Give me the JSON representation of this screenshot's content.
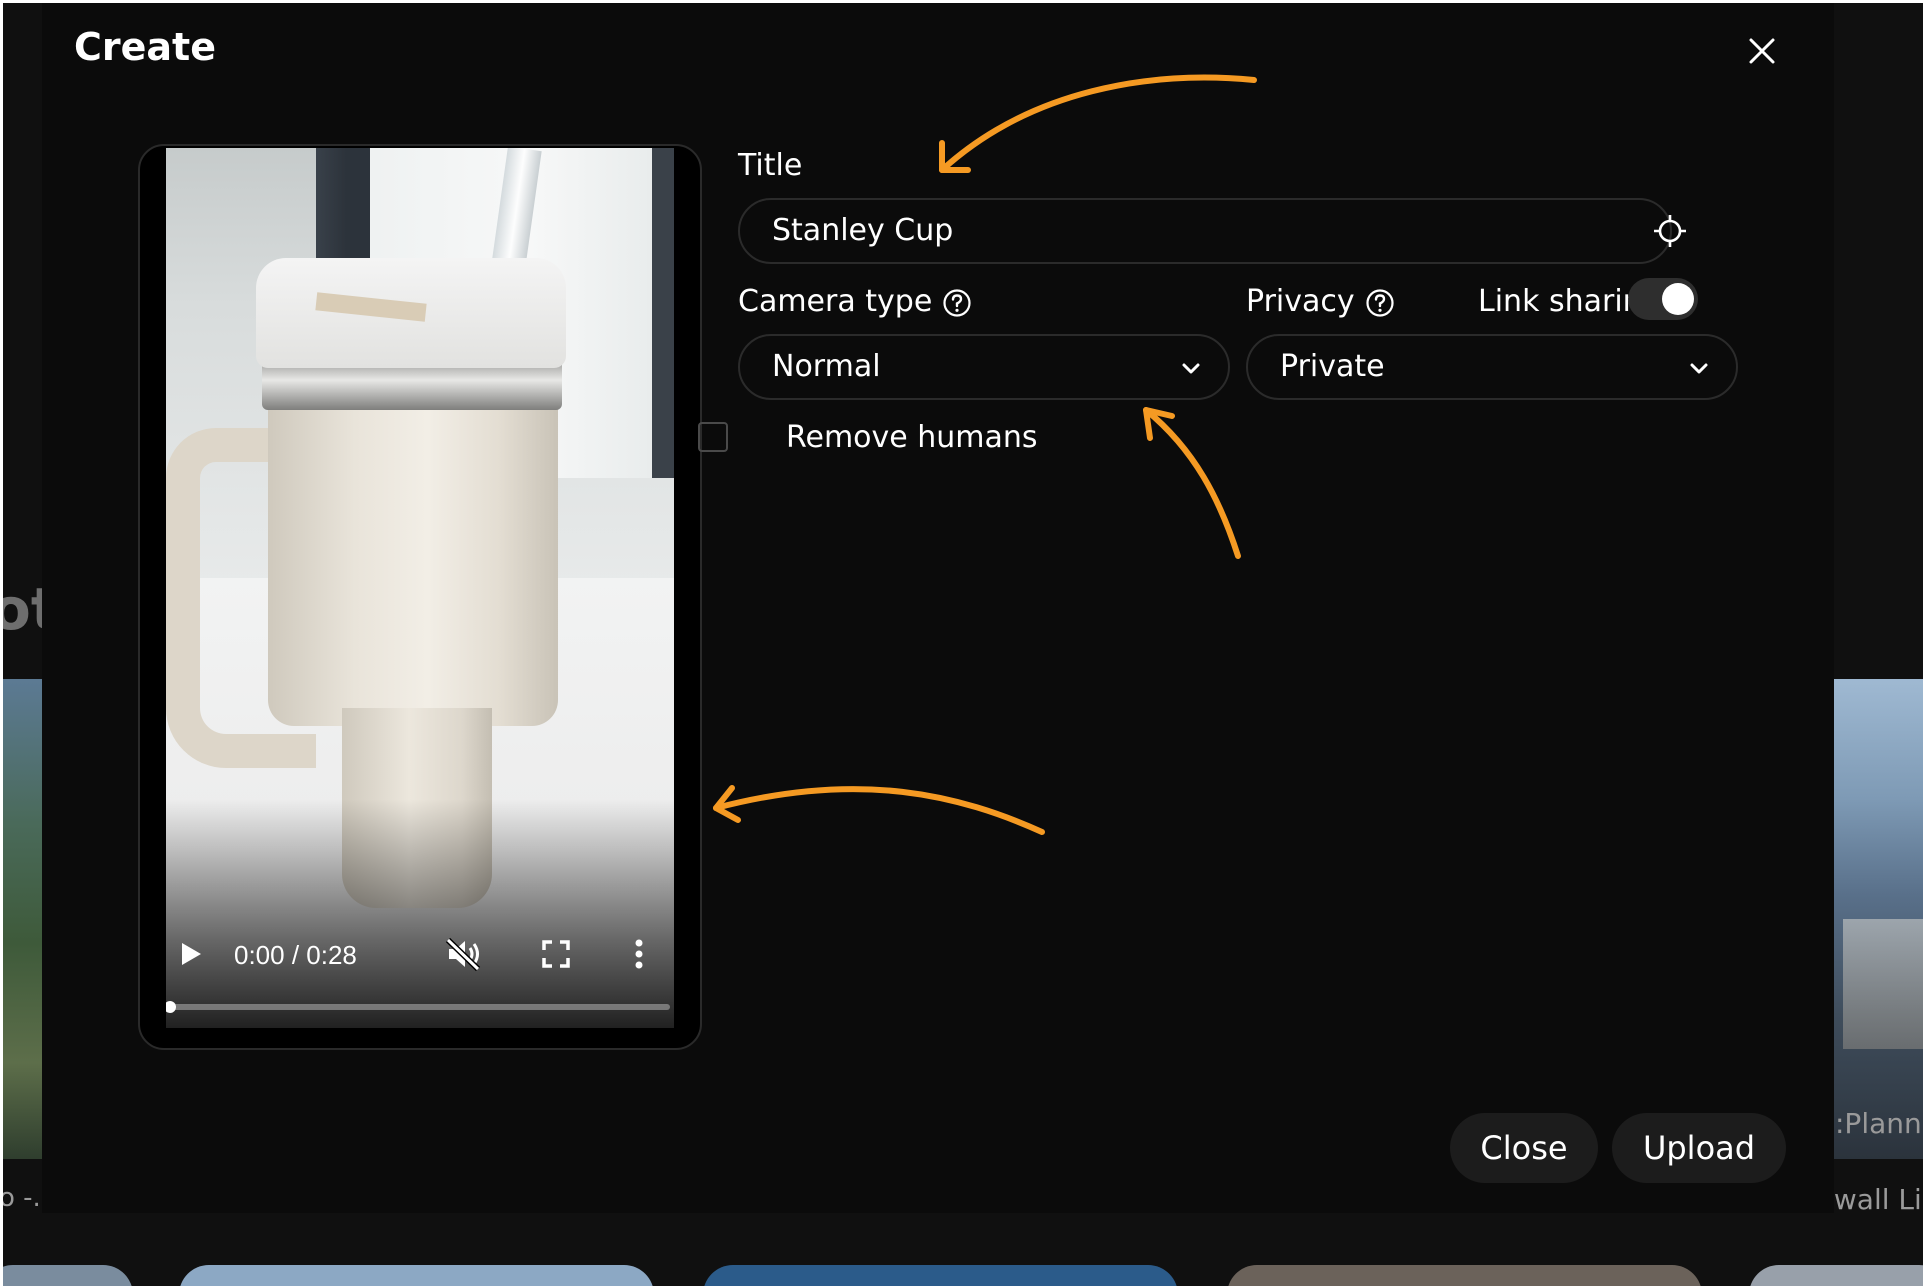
{
  "background": {
    "partial_heading": "ot",
    "left_card_caption": "o -..",
    "right_card_caption_1": ":Planne",
    "right_card_caption_2": ".wall Li"
  },
  "modal": {
    "title": "Create",
    "close_icon": "close-icon"
  },
  "video": {
    "current_time": "0:00",
    "duration": "0:28",
    "time_display": "0:00 / 0:28",
    "progress_fraction": 0.0,
    "muted": true,
    "controls_icons": [
      "play-icon",
      "volume-muted-icon",
      "fullscreen-icon",
      "more-vertical-icon"
    ]
  },
  "form": {
    "title_label": "Title",
    "title_value": "Stanley Cup",
    "location_icon": "crosshair-icon",
    "camera_type_label": "Camera type",
    "camera_type_value": "Normal",
    "privacy_label": "Privacy",
    "privacy_value": "Private",
    "link_sharing_label": "Link sharing",
    "link_sharing_enabled": true,
    "remove_humans_label": "Remove humans",
    "remove_humans_checked": false
  },
  "actions": {
    "close_label": "Close",
    "upload_label": "Upload"
  },
  "colors": {
    "modal_bg": "#0b0b0b",
    "field_border": "#2b2b2b",
    "button_bg": "#1c1c1c",
    "annotation_arrow": "#f59a23"
  }
}
